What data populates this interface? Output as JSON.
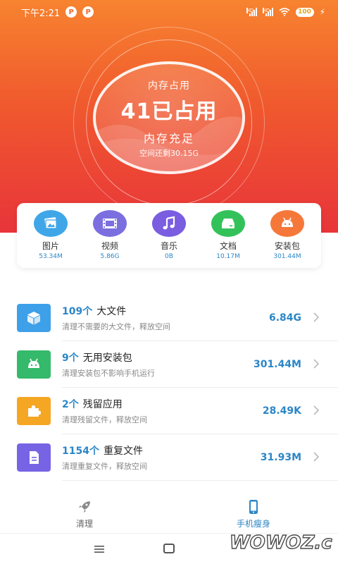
{
  "status_bar": {
    "time": "下午2:21",
    "notif_icons": [
      "P",
      "P"
    ],
    "signal_type": "HD",
    "battery": "100"
  },
  "memory": {
    "label": "内存占用",
    "value": "41已占用",
    "status": "内存充足",
    "free": "空间还剩30.15G"
  },
  "categories": [
    {
      "icon": "image-icon",
      "name": "图片",
      "size": "53.34M",
      "color": "#3fa6e8"
    },
    {
      "icon": "video-icon",
      "name": "视频",
      "size": "5.86G",
      "color": "#7b6fe0"
    },
    {
      "icon": "music-icon",
      "name": "音乐",
      "size": "0B",
      "color": "#7a5de0"
    },
    {
      "icon": "document-icon",
      "name": "文档",
      "size": "10.17M",
      "color": "#33c25a"
    },
    {
      "icon": "android-icon",
      "name": "安装包",
      "size": "301.44M",
      "color": "#f5783a"
    }
  ],
  "rows": [
    {
      "icon": "cube-icon",
      "color": "#3ea0e8",
      "count": "109个",
      "title": "大文件",
      "subtitle": "清理不需要的大文件，释放空间",
      "size": "6.84G"
    },
    {
      "icon": "android-icon",
      "color": "#35b96a",
      "count": "9个",
      "title": "无用安装包",
      "subtitle": "清理安装包不影响手机运行",
      "size": "301.44M"
    },
    {
      "icon": "puzzle-icon",
      "color": "#f5a623",
      "count": "2个",
      "title": "残留应用",
      "subtitle": "清理残留文件，释放空间",
      "size": "28.49K"
    },
    {
      "icon": "file-icon",
      "color": "#7764e4",
      "count": "1154个",
      "title": "重复文件",
      "subtitle": "清理重复文件，释放空间",
      "size": "31.93M"
    }
  ],
  "tabs": {
    "clean": "清理",
    "slim": "手机瘦身"
  },
  "watermark": "WOWOZ.com",
  "colors": {
    "accent": "#2b86c6",
    "hero_top": "#f7832f",
    "hero_bottom": "#e8343a"
  }
}
